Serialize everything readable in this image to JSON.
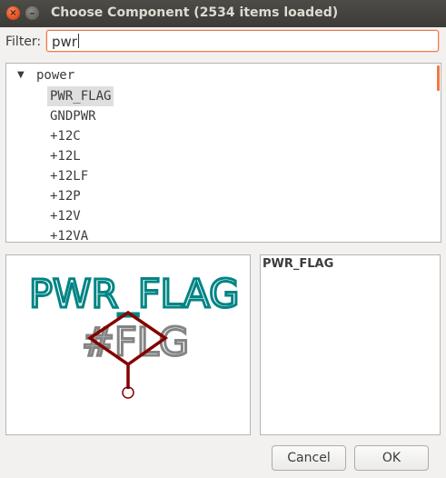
{
  "window": {
    "title": "Choose Component (2534 items loaded)",
    "close_glyph": "×",
    "minimize_glyph": "–"
  },
  "filter": {
    "label": "Filter:",
    "value": "pwr"
  },
  "tree": {
    "group_label": "power",
    "expanded_glyph": "▼",
    "items": [
      {
        "label": "PWR_FLAG",
        "selected": true
      },
      {
        "label": "GNDPWR",
        "selected": false
      },
      {
        "label": "+12C",
        "selected": false
      },
      {
        "label": "+12L",
        "selected": false
      },
      {
        "label": "+12LF",
        "selected": false
      },
      {
        "label": "+12P",
        "selected": false
      },
      {
        "label": "+12V",
        "selected": false
      },
      {
        "label": "+12VA",
        "selected": false
      }
    ]
  },
  "preview": {
    "value_text": "PWR_FLAG",
    "reference_text": "#FLG",
    "value_color": "#008484",
    "reference_color": "#848484",
    "body_color": "#840000"
  },
  "details": {
    "title": "PWR_FLAG"
  },
  "buttons": {
    "cancel_label": "Cancel",
    "ok_label": "OK"
  }
}
